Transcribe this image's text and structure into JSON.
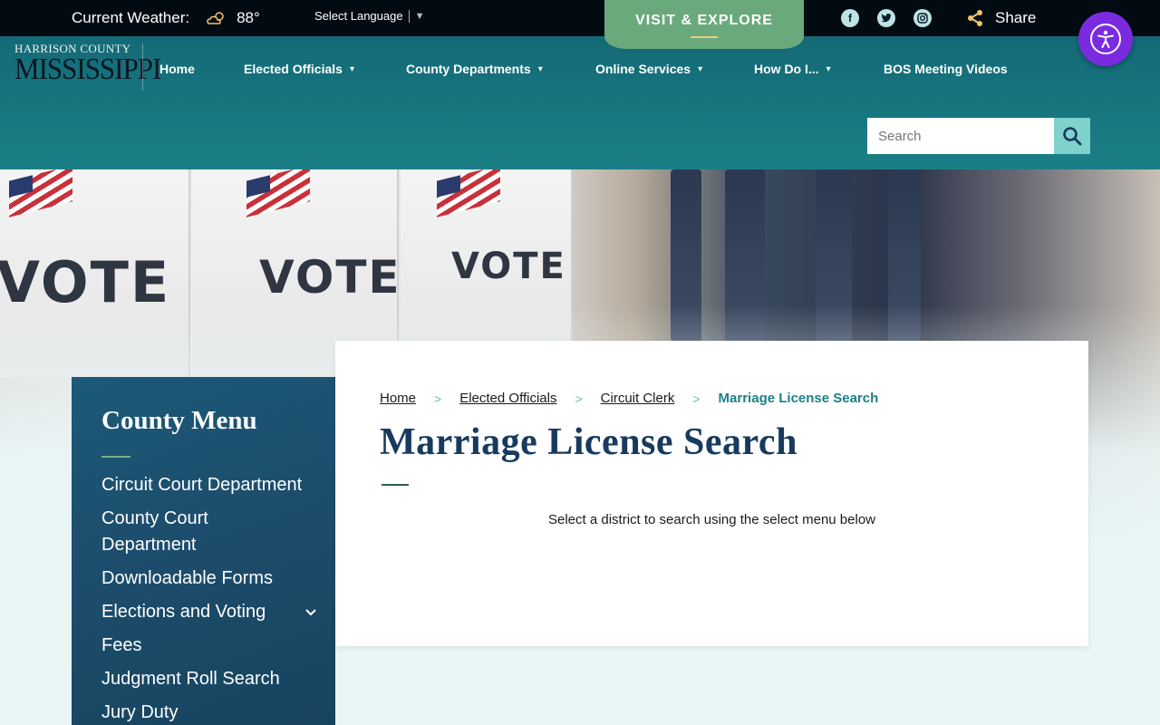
{
  "topbar": {
    "weather_label": "Current Weather:",
    "weather_temp": "88°",
    "language_label": "Select Language",
    "visit_label": "VISIT & EXPLORE",
    "share_label": "Share"
  },
  "logo": {
    "line1": "HARRISON COUNTY",
    "line2": "MISSISSIPPI"
  },
  "nav": {
    "items": [
      {
        "label": "Home",
        "dropdown": false
      },
      {
        "label": "Elected Officials",
        "dropdown": true
      },
      {
        "label": "County Departments",
        "dropdown": true
      },
      {
        "label": "Online Services",
        "dropdown": true
      },
      {
        "label": "How Do I...",
        "dropdown": true
      },
      {
        "label": "BOS Meeting Videos",
        "dropdown": false
      }
    ]
  },
  "search": {
    "placeholder": "Search"
  },
  "hero": {
    "vote_word": "VOTE"
  },
  "sidebar": {
    "title": "County Menu",
    "items": [
      {
        "label": "Circuit Court Department"
      },
      {
        "label": "County Court Department"
      },
      {
        "label": "Downloadable Forms"
      },
      {
        "label": "Elections and Voting"
      },
      {
        "label": "Fees"
      },
      {
        "label": "Judgment Roll Search"
      },
      {
        "label": "Jury Duty"
      }
    ]
  },
  "breadcrumb": {
    "home": "Home",
    "elected": "Elected Officials",
    "clerk": "Circuit Clerk",
    "current": "Marriage License Search",
    "separator": ">"
  },
  "page": {
    "title": "Marriage License Search",
    "description": "Select a district to search using the select menu below"
  },
  "colors": {
    "accent": "#1b7f86",
    "header": "#136a76",
    "visit": "#6aa97b",
    "sidebar": "#1d4e6d",
    "access": "#7a2be0"
  }
}
